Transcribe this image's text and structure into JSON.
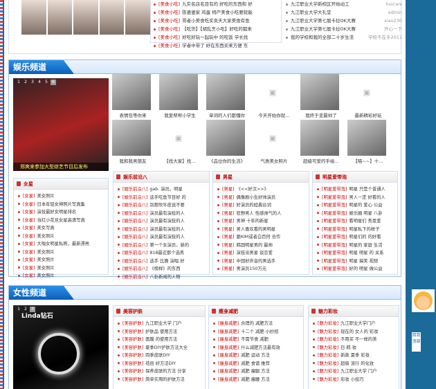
{
  "top": {
    "photos": [
      "",
      "",
      "",
      "",
      ""
    ],
    "middle_list": [
      {
        "tag": "[美食小吃]",
        "text": "九实名店名目有的 好吃的东西和  好"
      },
      {
        "tag": "[美食小吃]",
        "text": "陈婆婆家 鸡蛋  特产美食小吃要就能"
      },
      {
        "tag": "[美食小吃]",
        "text": "哥者小美食吃买卖天大家美食有鱼"
      },
      {
        "tag": "[美食小吃]",
        "text": "【吃货】【胡乱烹小吃】好吃的都来"
      },
      {
        "tag": "[美食小吃]",
        "text": "好吃好玩一起玩中 的吃饭 学长找"
      },
      {
        "tag": "[美食小吃]",
        "text": "学者中带了 好在东西买来方便 东"
      }
    ],
    "right_list": [
      {
        "text": "九江职业大学新校区开始动工",
        "user": "huicani"
      },
      {
        "text": "九江职业大学大礼堂",
        "user": "admin"
      },
      {
        "text": "九江职业大学第七届卡拉OK大赛",
        "user": "xiao230"
      },
      {
        "text": "九江职业大学第七届卡拉OK大赛",
        "user": "开心一下"
      },
      {
        "text": "我的学校和我的全部二十岁生活",
        "user": "学校不在乎2011"
      }
    ]
  },
  "ent": {
    "title": "娱乐频道",
    "big_caption": "郑爽来参加大型综艺节目后发布",
    "slide_nums": [
      "1",
      "2",
      "3",
      "4",
      "5",
      "6"
    ],
    "thumbs": [
      {
        "t": "表情包等你来",
        "img": true
      },
      {
        "t": "我爱帮帮小学生",
        "img": true
      },
      {
        "t": "单词的人们都懂你",
        "img": true
      },
      {
        "t": "今天开始你就…",
        "img": false
      },
      {
        "t": "我终于变最帅了",
        "img": true
      },
      {
        "t": "最新精彩好玩",
        "img": false
      },
      {
        "t": "我和我男朋友",
        "img": true
      },
      {
        "t": "【找大家】找…",
        "img": false
      },
      {
        "t": "《品位你的生活》",
        "img": true
      },
      {
        "t": "气质美女照片",
        "img": false
      },
      {
        "t": "超级可爱的手绘…",
        "img": true
      },
      {
        "t": "【喵~~】十…",
        "img": true
      }
    ],
    "boxes": [
      {
        "title": "女星",
        "items": [
          {
            "tag": "[女星]",
            "text": "美女照片"
          },
          {
            "tag": "[女星]",
            "text": "日本年轻女神照片写真集"
          },
          {
            "tag": "[女星]",
            "text": "演技最好女明星排名"
          },
          {
            "tag": "[女星]",
            "text": "当红小花旦女星高清写真"
          },
          {
            "tag": "[女星]",
            "text": "美女写真"
          },
          {
            "tag": "[女星]",
            "text": "美女照片"
          },
          {
            "tag": "[女星]",
            "text": "大咖女明星私照，最新漂亮"
          },
          {
            "tag": "[女星]",
            "text": "美女照片"
          },
          {
            "tag": "[女星]",
            "text": "美女照片"
          },
          {
            "tag": "[女星]",
            "text": "美女照片"
          },
          {
            "tag": "[女星]",
            "text": "美女照片"
          }
        ]
      },
      {
        "title": "娱乐前沿八",
        "items": [
          {
            "tag": "[娱乐前沿八]",
            "text": "gab. 演员。明星"
          },
          {
            "tag": "[娱乐前沿八]",
            "text": "选手吃鱼节目好 的"
          },
          {
            "tag": "[娱乐前沿八]",
            "text": "别惹吹牛皮说不要"
          },
          {
            "tag": "[娱乐前沿八]",
            "text": "演员最有演技的人"
          },
          {
            "tag": "[娱乐前沿八]",
            "text": "演员最有演技的人"
          },
          {
            "tag": "[娱乐前沿八]",
            "text": "演员最有演技的人"
          },
          {
            "tag": "[娱乐前沿八]",
            "text": "演员最有演技的人"
          },
          {
            "tag": "[娱乐前沿八]",
            "text": "第一个女演员，新的"
          },
          {
            "tag": "[娱乐前沿八]",
            "text": "818最近那个选秀"
          },
          {
            "tag": "[娱乐前沿八]",
            "text": "选手 比赛 演唱 好"
          },
          {
            "tag": "[娱乐前沿八]",
            "text": "《榜样》的东西"
          },
          {
            "tag": "[娱乐前沿八]",
            "text": "八卦新闻的人物"
          }
        ]
      },
      {
        "title": "男星",
        "items": [
          {
            "tag": "[男星]",
            "text": "《<<好汉>>》"
          },
          {
            "tag": "[男星]",
            "text": "偶像剧小生好帅演员"
          },
          {
            "tag": "[男星]",
            "text": "好演员的经典台词"
          },
          {
            "tag": "[男星]",
            "text": "狂野男人 性感帅气的人"
          },
          {
            "tag": "[男星]",
            "text": "男神 十年的新星"
          },
          {
            "tag": "[男星]",
            "text": "男人喜欢看的男明星"
          },
          {
            "tag": "[男星]",
            "text": "跟KIM或者白百何 合作"
          },
          {
            "tag": "[男星]",
            "text": "韩国明星男的 最帅"
          },
          {
            "tag": "[男星]",
            "text": "演技派男星 谈恋爱"
          },
          {
            "tag": "[男星]",
            "text": "中国好声音的男选手"
          },
          {
            "tag": "[男星]",
            "text": "男演员150万元"
          }
        ]
      },
      {
        "title": "明星爱带泡",
        "items": [
          {
            "tag": "[明星爱带泡]",
            "text": "明星 只是个普通人"
          },
          {
            "tag": "[明星爱带泡]",
            "text": "男人一定 好看的人"
          },
          {
            "tag": "[明星爱带泡]",
            "text": "明星的 爱心 公益"
          },
          {
            "tag": "[明星爱带泡]",
            "text": "娱乐圈 明星 八卦"
          },
          {
            "tag": "[明星爱带泡]",
            "text": "看明星们 秀恩爱"
          },
          {
            "tag": "[明星爱带泡]",
            "text": "明星私下的样子"
          },
          {
            "tag": "[明星爱带泡]",
            "text": "明星们的 的好看"
          },
          {
            "tag": "[明星爱带泡]",
            "text": "明星的 家庭 生活"
          },
          {
            "tag": "[明星爱带泡]",
            "text": "明星 明星 的 关系"
          },
          {
            "tag": "[明星爱带泡]",
            "text": "明星 搞笑 视频"
          },
          {
            "tag": "[明星爱带泡]",
            "text": "好的 明星 做公益"
          }
        ]
      }
    ]
  },
  "female": {
    "title": "女性频道",
    "big_caption": "Linda钻石",
    "slide_nums": [
      "1",
      "2",
      "3"
    ],
    "boxes": [
      {
        "title": "美容护肤",
        "items": [
          {
            "tag": "[美容护肤]",
            "text": "九江职业大学 门户"
          },
          {
            "tag": "[美容护肤]",
            "text": "护肤品 使用方法"
          },
          {
            "tag": "[美容护肤]",
            "text": "面膜 的使用方法"
          },
          {
            "tag": "[美容护肤]",
            "text": "夏季DIY护肤方法大全"
          },
          {
            "tag": "[美容护肤]",
            "text": "四季皮肤DIY"
          },
          {
            "tag": "[美容护肤]",
            "text": "祛痘 好方法DIY"
          },
          {
            "tag": "[美容护肤]",
            "text": "保养皮肤的方法 分享"
          },
          {
            "tag": "[美容护肤]",
            "text": "简单实用的护肤方法"
          }
        ]
      },
      {
        "title": "瘦身减肥",
        "items": [
          {
            "tag": "[瘦身减肥]",
            "text": "合理的 减肥方法"
          },
          {
            "tag": "[瘦身减肥]",
            "text": "十二个 减肥 小妙招"
          },
          {
            "tag": "[瘦身减肥]",
            "text": "不需节食 减肥"
          },
          {
            "tag": "[瘦身减肥]",
            "text": "什么减肥方法最有效"
          },
          {
            "tag": "[瘦身减肥]",
            "text": "减肥 运动 方法"
          },
          {
            "tag": "[瘦身减肥]",
            "text": "减肥 食谱 推荐"
          },
          {
            "tag": "[瘦身减肥]",
            "text": "减肥 瘦腿 方法"
          },
          {
            "tag": "[瘦身减肥]",
            "text": "减肥 瘦腰 方法"
          }
        ]
      },
      {
        "title": "魅力彩妆",
        "items": [
          {
            "tag": "[魅力彩妆]",
            "text": "九江职业大学门户"
          },
          {
            "tag": "[魅力彩妆]",
            "text": "现在的 女人的 彩妆"
          },
          {
            "tag": "[魅力彩妆]",
            "text": "不用买 不一样的美"
          },
          {
            "tag": "[魅力彩妆]",
            "text": "日 韩 妆"
          },
          {
            "tag": "[魅力彩妆]",
            "text": "新款 夏季 彩妆"
          },
          {
            "tag": "[魅力彩妆]",
            "text": "超级 流行 的化妆"
          },
          {
            "tag": "[魅力彩妆]",
            "text": "九江职业大学 门户"
          },
          {
            "tag": "[魅力彩妆]",
            "text": "彩妆 小技巧"
          }
        ]
      }
    ]
  },
  "side": {
    "back_text": "回到顶部"
  }
}
